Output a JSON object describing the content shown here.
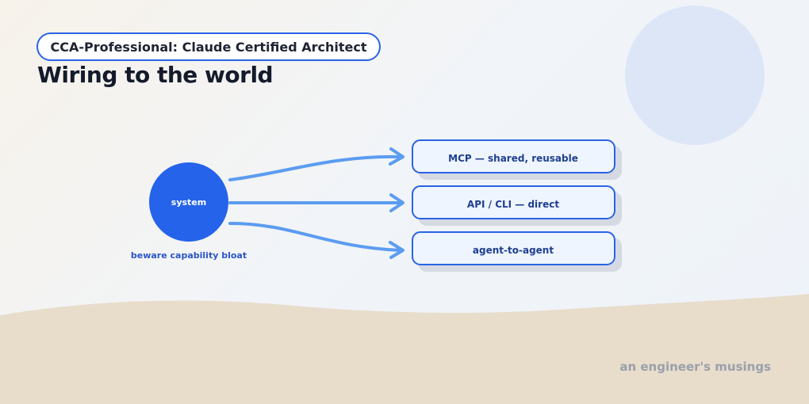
{
  "header": {
    "badge": "CCA-Professional: Claude Certified Architect",
    "title": "Wiring to the world"
  },
  "diagram": {
    "source": {
      "label": "system",
      "caption": "beware capability bloat"
    },
    "targets": [
      {
        "label": "MCP — shared, reusable"
      },
      {
        "label": "API / CLI — direct"
      },
      {
        "label": "agent-to-agent"
      }
    ]
  },
  "footer": {
    "text": "an engineer's musings"
  },
  "colors": {
    "accent": "#2b63e6",
    "node": "#2563eb",
    "arrow": "#5b9cf0",
    "box_fill": "#eef5ff",
    "box_border": "#2b63e6",
    "sand": "#e8dccb",
    "sun": "#dde6f7",
    "text_dark": "#131a2b",
    "caption": "#2b55c9",
    "footer": "#9aa0ab"
  }
}
